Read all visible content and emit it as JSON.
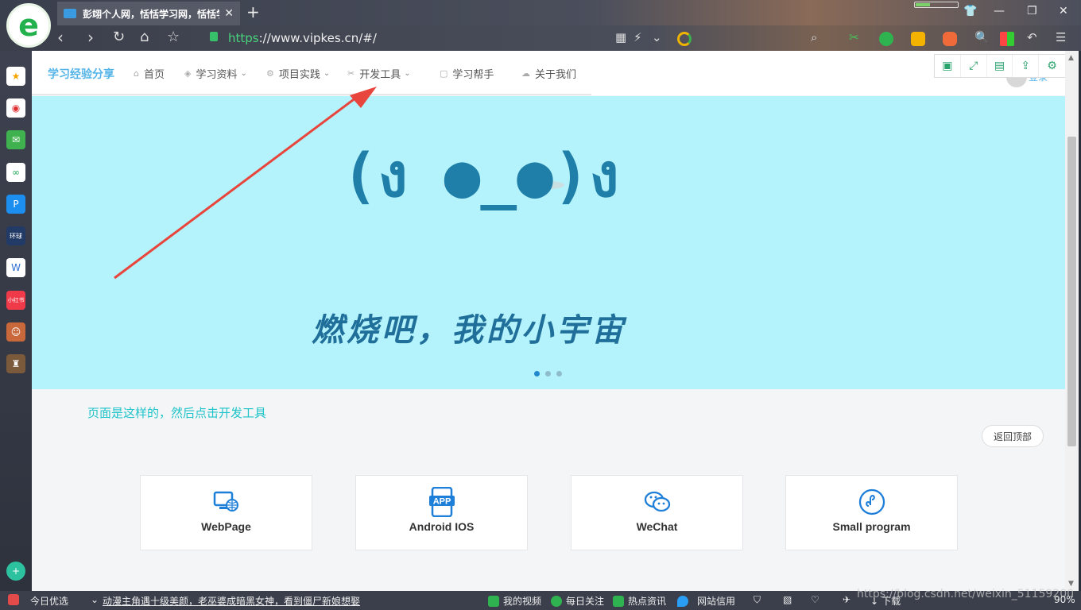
{
  "browser": {
    "tab_title": "彭翊个人网，恬恬学习网，恬恬学",
    "tab_close": "✕",
    "new_tab": "+",
    "url_scheme": "https",
    "url_rest": "://www.vipkes.cn/#/",
    "zoom": "90%"
  },
  "site": {
    "logo": "学习经验分享",
    "nav": [
      {
        "label": "首页",
        "icon": "home-icon",
        "glyph": "⌂"
      },
      {
        "label": "学习资料",
        "icon": "cube-icon",
        "glyph": "◈",
        "chevron": "⌄"
      },
      {
        "label": "项目实践",
        "icon": "gear-icon",
        "glyph": "⚙",
        "chevron": "⌄"
      },
      {
        "label": "开发工具",
        "icon": "tools-icon",
        "glyph": "✂",
        "chevron": "⌄"
      },
      {
        "label": "学习帮手",
        "icon": "book-icon",
        "glyph": "▢"
      },
      {
        "label": "关于我们",
        "icon": "about-icon",
        "glyph": "☁"
      }
    ],
    "login": "登录"
  },
  "banner": {
    "face": "(ง ●_●)ง",
    "slogan": "燃烧吧，我的小宇宙"
  },
  "caption": "页面是这样的，然后点击开发工具",
  "back_top": "返回顶部",
  "cards": [
    {
      "label": "WebPage",
      "icon": "webpage-icon"
    },
    {
      "label": "Android IOS",
      "icon": "app-icon",
      "badge": "APP"
    },
    {
      "label": "WeChat",
      "icon": "wechat-icon"
    },
    {
      "label": "Small program",
      "icon": "miniprogram-icon"
    }
  ],
  "statusbar": {
    "daily": "今日优选",
    "news": "动漫主角遇十级美颜，老巫婆成暗黑女神，看到僵尸新娘想娶",
    "video": "我的视频",
    "follow": "每日关注",
    "hot": "热点资讯",
    "credit": "网站信用",
    "download": "下载",
    "zoom": "90%"
  },
  "watermark": "https://blog.csdn.net/weixin_51159200",
  "colors": {
    "accent": "#54b4e8",
    "banner": "#b4f3fb",
    "caption": "#1ec4c9",
    "arrow": "#e8453c"
  }
}
